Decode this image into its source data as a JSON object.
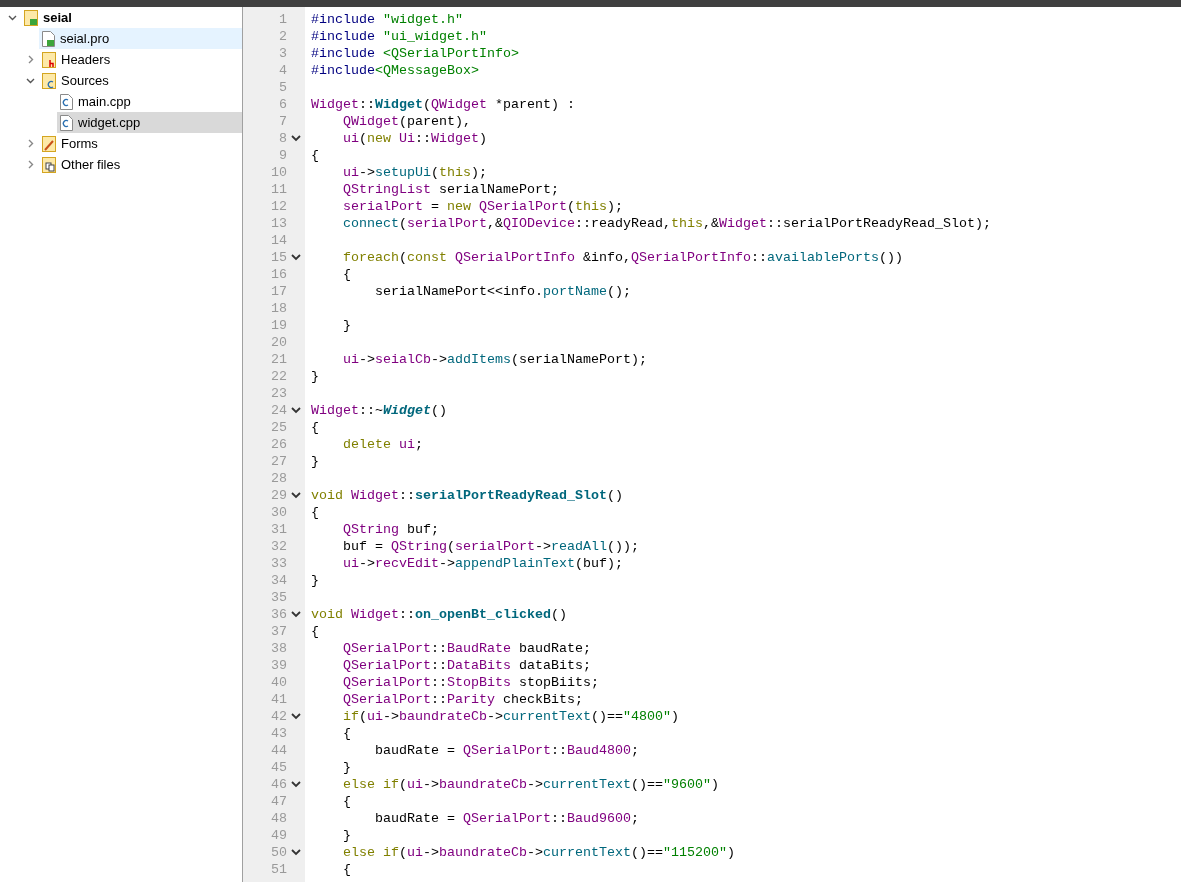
{
  "project_tree": [
    {
      "label": "seial",
      "kind": "project",
      "expanded": true,
      "selected": false,
      "open": false,
      "children": [
        {
          "label": "seial.pro",
          "kind": "pro-file",
          "selected": true,
          "open": false
        },
        {
          "label": "Headers",
          "kind": "headers",
          "expanded": false,
          "selected": false,
          "open": false
        },
        {
          "label": "Sources",
          "kind": "sources",
          "expanded": true,
          "selected": false,
          "open": false,
          "children": [
            {
              "label": "main.cpp",
              "kind": "cpp",
              "selected": false,
              "open": false
            },
            {
              "label": "widget.cpp",
              "kind": "cpp",
              "selected": false,
              "open": true
            }
          ]
        },
        {
          "label": "Forms",
          "kind": "forms",
          "expanded": false,
          "selected": false,
          "open": false
        },
        {
          "label": "Other files",
          "kind": "other",
          "expanded": false,
          "selected": false,
          "open": false
        }
      ]
    }
  ],
  "editor": {
    "lines": [
      {
        "number": "1",
        "foldable": false,
        "tokens": [
          {
            "kind": "pp",
            "text": "#include "
          },
          {
            "kind": "str",
            "text": "\"widget.h\""
          }
        ]
      },
      {
        "number": "2",
        "foldable": false,
        "tokens": [
          {
            "kind": "pp",
            "text": "#include "
          },
          {
            "kind": "str",
            "text": "\"ui_widget.h\""
          }
        ]
      },
      {
        "number": "3",
        "foldable": false,
        "tokens": [
          {
            "kind": "pp",
            "text": "#include "
          },
          {
            "kind": "str",
            "text": "<QSerialPortInfo>"
          }
        ]
      },
      {
        "number": "4",
        "foldable": false,
        "tokens": [
          {
            "kind": "pp",
            "text": "#include"
          },
          {
            "kind": "str",
            "text": "<QMessageBox>"
          }
        ]
      },
      {
        "number": "5",
        "foldable": false
      },
      {
        "number": "6",
        "foldable": false,
        "tokens": [
          {
            "kind": "type",
            "text": "Widget"
          },
          {
            "kind": "plain",
            "text": "::"
          },
          {
            "kind": "decl",
            "text": "Widget"
          },
          {
            "kind": "plain",
            "text": "("
          },
          {
            "kind": "type",
            "text": "QWidget"
          },
          {
            "kind": "plain",
            "text": " *parent) :"
          }
        ]
      },
      {
        "number": "7",
        "foldable": false,
        "tokens": [
          {
            "kind": "type",
            "text": "    QWidget"
          },
          {
            "kind": "plain",
            "text": "(parent),"
          }
        ]
      },
      {
        "number": "8",
        "foldable": true,
        "tokens": [
          {
            "kind": "type",
            "text": "    ui"
          },
          {
            "kind": "plain",
            "text": "("
          },
          {
            "kind": "kw",
            "text": "new "
          },
          {
            "kind": "type",
            "text": "Ui"
          },
          {
            "kind": "plain",
            "text": "::"
          },
          {
            "kind": "type",
            "text": "Widget"
          },
          {
            "kind": "plain",
            "text": ")"
          }
        ]
      },
      {
        "number": "9",
        "foldable": false,
        "tokens": [
          {
            "kind": "plain",
            "text": "{"
          }
        ]
      },
      {
        "number": "10",
        "foldable": false,
        "tokens": [
          {
            "kind": "type",
            "text": "    ui"
          },
          {
            "kind": "plain",
            "text": "->"
          },
          {
            "kind": "fn",
            "text": "setupUi"
          },
          {
            "kind": "plain",
            "text": "("
          },
          {
            "kind": "kw",
            "text": "this"
          },
          {
            "kind": "plain",
            "text": ");"
          }
        ]
      },
      {
        "number": "11",
        "foldable": false,
        "tokens": [
          {
            "kind": "type",
            "text": "    QStringList"
          },
          {
            "kind": "plain",
            "text": " serialNamePort;"
          }
        ]
      },
      {
        "number": "12",
        "foldable": false,
        "tokens": [
          {
            "kind": "type",
            "text": "    serialPort"
          },
          {
            "kind": "plain",
            "text": " = "
          },
          {
            "kind": "kw",
            "text": "new "
          },
          {
            "kind": "type",
            "text": "QSerialPort"
          },
          {
            "kind": "plain",
            "text": "("
          },
          {
            "kind": "kw",
            "text": "this"
          },
          {
            "kind": "plain",
            "text": ");"
          }
        ]
      },
      {
        "number": "13",
        "foldable": false,
        "tokens": [
          {
            "kind": "fn",
            "text": "    connect"
          },
          {
            "kind": "plain",
            "text": "("
          },
          {
            "kind": "type",
            "text": "serialPort"
          },
          {
            "kind": "plain",
            "text": ",&"
          },
          {
            "kind": "type",
            "text": "QIODevice"
          },
          {
            "kind": "plain",
            "text": "::readyRead,"
          },
          {
            "kind": "kw",
            "text": "this"
          },
          {
            "kind": "plain",
            "text": ",&"
          },
          {
            "kind": "type",
            "text": "Widget"
          },
          {
            "kind": "plain",
            "text": "::serialPortReadyRead_Slot);"
          }
        ]
      },
      {
        "number": "14",
        "foldable": false
      },
      {
        "number": "15",
        "foldable": true,
        "tokens": [
          {
            "kind": "kw",
            "text": "    foreach"
          },
          {
            "kind": "plain",
            "text": "("
          },
          {
            "kind": "kw",
            "text": "const "
          },
          {
            "kind": "type",
            "text": "QSerialPortInfo"
          },
          {
            "kind": "plain",
            "text": " &info,"
          },
          {
            "kind": "type",
            "text": "QSerialPortInfo"
          },
          {
            "kind": "plain",
            "text": "::"
          },
          {
            "kind": "fn",
            "text": "availablePorts"
          },
          {
            "kind": "plain",
            "text": "())"
          }
        ]
      },
      {
        "number": "16",
        "foldable": false,
        "tokens": [
          {
            "kind": "plain",
            "text": "    {"
          }
        ]
      },
      {
        "number": "17",
        "foldable": false,
        "tokens": [
          {
            "kind": "plain",
            "text": "        serialNamePort<<info."
          },
          {
            "kind": "fn",
            "text": "portName"
          },
          {
            "kind": "plain",
            "text": "();"
          }
        ]
      },
      {
        "number": "18",
        "foldable": false
      },
      {
        "number": "19",
        "foldable": false,
        "tokens": [
          {
            "kind": "plain",
            "text": "    }"
          }
        ]
      },
      {
        "number": "20",
        "foldable": false
      },
      {
        "number": "21",
        "foldable": false,
        "tokens": [
          {
            "kind": "type",
            "text": "    ui"
          },
          {
            "kind": "plain",
            "text": "->"
          },
          {
            "kind": "type",
            "text": "seialCb"
          },
          {
            "kind": "plain",
            "text": "->"
          },
          {
            "kind": "fn",
            "text": "addItems"
          },
          {
            "kind": "plain",
            "text": "(serialNamePort);"
          }
        ]
      },
      {
        "number": "22",
        "foldable": false,
        "tokens": [
          {
            "kind": "plain",
            "text": "}"
          }
        ]
      },
      {
        "number": "23",
        "foldable": false
      },
      {
        "number": "24",
        "foldable": true,
        "tokens": [
          {
            "kind": "type",
            "text": "Widget"
          },
          {
            "kind": "plain",
            "text": "::~"
          },
          {
            "kind": "decl-italic",
            "text": "Widget"
          },
          {
            "kind": "plain",
            "text": "()"
          }
        ]
      },
      {
        "number": "25",
        "foldable": false,
        "tokens": [
          {
            "kind": "plain",
            "text": "{"
          }
        ]
      },
      {
        "number": "26",
        "foldable": false,
        "tokens": [
          {
            "kind": "kw",
            "text": "    delete "
          },
          {
            "kind": "type",
            "text": "ui"
          },
          {
            "kind": "plain",
            "text": ";"
          }
        ]
      },
      {
        "number": "27",
        "foldable": false,
        "tokens": [
          {
            "kind": "plain",
            "text": "}"
          }
        ]
      },
      {
        "number": "28",
        "foldable": false
      },
      {
        "number": "29",
        "foldable": true,
        "tokens": [
          {
            "kind": "kw",
            "text": "void "
          },
          {
            "kind": "type",
            "text": "Widget"
          },
          {
            "kind": "plain",
            "text": "::"
          },
          {
            "kind": "decl",
            "text": "serialPortReadyRead_Slot"
          },
          {
            "kind": "plain",
            "text": "()"
          }
        ]
      },
      {
        "number": "30",
        "foldable": false,
        "tokens": [
          {
            "kind": "plain",
            "text": "{"
          }
        ]
      },
      {
        "number": "31",
        "foldable": false,
        "tokens": [
          {
            "kind": "type",
            "text": "    QString"
          },
          {
            "kind": "plain",
            "text": " buf;"
          }
        ]
      },
      {
        "number": "32",
        "foldable": false,
        "tokens": [
          {
            "kind": "plain",
            "text": "    buf = "
          },
          {
            "kind": "type",
            "text": "QString"
          },
          {
            "kind": "plain",
            "text": "("
          },
          {
            "kind": "type",
            "text": "serialPort"
          },
          {
            "kind": "plain",
            "text": "->"
          },
          {
            "kind": "fn",
            "text": "readAll"
          },
          {
            "kind": "plain",
            "text": "());"
          }
        ]
      },
      {
        "number": "33",
        "foldable": false,
        "tokens": [
          {
            "kind": "type",
            "text": "    ui"
          },
          {
            "kind": "plain",
            "text": "->"
          },
          {
            "kind": "type",
            "text": "recvEdit"
          },
          {
            "kind": "plain",
            "text": "->"
          },
          {
            "kind": "fn",
            "text": "appendPlainText"
          },
          {
            "kind": "plain",
            "text": "(buf);"
          }
        ]
      },
      {
        "number": "34",
        "foldable": false,
        "tokens": [
          {
            "kind": "plain",
            "text": "}"
          }
        ]
      },
      {
        "number": "35",
        "foldable": false
      },
      {
        "number": "36",
        "foldable": true,
        "tokens": [
          {
            "kind": "kw",
            "text": "void "
          },
          {
            "kind": "type",
            "text": "Widget"
          },
          {
            "kind": "plain",
            "text": "::"
          },
          {
            "kind": "decl",
            "text": "on_openBt_clicked"
          },
          {
            "kind": "plain",
            "text": "()"
          }
        ]
      },
      {
        "number": "37",
        "foldable": false,
        "tokens": [
          {
            "kind": "plain",
            "text": "{"
          }
        ]
      },
      {
        "number": "38",
        "foldable": false,
        "tokens": [
          {
            "kind": "type",
            "text": "    QSerialPort"
          },
          {
            "kind": "plain",
            "text": "::"
          },
          {
            "kind": "type",
            "text": "BaudRate"
          },
          {
            "kind": "plain",
            "text": " baudRate;"
          }
        ]
      },
      {
        "number": "39",
        "foldable": false,
        "tokens": [
          {
            "kind": "type",
            "text": "    QSerialPort"
          },
          {
            "kind": "plain",
            "text": "::"
          },
          {
            "kind": "type",
            "text": "DataBits"
          },
          {
            "kind": "plain",
            "text": " dataBits;"
          }
        ]
      },
      {
        "number": "40",
        "foldable": false,
        "tokens": [
          {
            "kind": "type",
            "text": "    QSerialPort"
          },
          {
            "kind": "plain",
            "text": "::"
          },
          {
            "kind": "type",
            "text": "StopBits"
          },
          {
            "kind": "plain",
            "text": " stopBiits;"
          }
        ]
      },
      {
        "number": "41",
        "foldable": false,
        "tokens": [
          {
            "kind": "type",
            "text": "    QSerialPort"
          },
          {
            "kind": "plain",
            "text": "::"
          },
          {
            "kind": "type",
            "text": "Parity"
          },
          {
            "kind": "plain",
            "text": " checkBits;"
          }
        ]
      },
      {
        "number": "42",
        "foldable": true,
        "tokens": [
          {
            "kind": "kw",
            "text": "    if"
          },
          {
            "kind": "plain",
            "text": "("
          },
          {
            "kind": "type",
            "text": "ui"
          },
          {
            "kind": "plain",
            "text": "->"
          },
          {
            "kind": "type",
            "text": "baundrateCb"
          },
          {
            "kind": "plain",
            "text": "->"
          },
          {
            "kind": "fn",
            "text": "currentText"
          },
          {
            "kind": "plain",
            "text": "()=="
          },
          {
            "kind": "str",
            "text": "\"4800\""
          },
          {
            "kind": "plain",
            "text": ")"
          }
        ]
      },
      {
        "number": "43",
        "foldable": false,
        "tokens": [
          {
            "kind": "plain",
            "text": "    {"
          }
        ]
      },
      {
        "number": "44",
        "foldable": false,
        "tokens": [
          {
            "kind": "plain",
            "text": "        baudRate = "
          },
          {
            "kind": "type",
            "text": "QSerialPort"
          },
          {
            "kind": "plain",
            "text": "::"
          },
          {
            "kind": "type",
            "text": "Baud4800"
          },
          {
            "kind": "plain",
            "text": ";"
          }
        ]
      },
      {
        "number": "45",
        "foldable": false,
        "tokens": [
          {
            "kind": "plain",
            "text": "    }"
          }
        ]
      },
      {
        "number": "46",
        "foldable": true,
        "tokens": [
          {
            "kind": "kw",
            "text": "    else if"
          },
          {
            "kind": "plain",
            "text": "("
          },
          {
            "kind": "type",
            "text": "ui"
          },
          {
            "kind": "plain",
            "text": "->"
          },
          {
            "kind": "type",
            "text": "baundrateCb"
          },
          {
            "kind": "plain",
            "text": "->"
          },
          {
            "kind": "fn",
            "text": "currentText"
          },
          {
            "kind": "plain",
            "text": "()=="
          },
          {
            "kind": "str",
            "text": "\"9600\""
          },
          {
            "kind": "plain",
            "text": ")"
          }
        ]
      },
      {
        "number": "47",
        "foldable": false,
        "tokens": [
          {
            "kind": "plain",
            "text": "    {"
          }
        ]
      },
      {
        "number": "48",
        "foldable": false,
        "tokens": [
          {
            "kind": "plain",
            "text": "        baudRate = "
          },
          {
            "kind": "type",
            "text": "QSerialPort"
          },
          {
            "kind": "plain",
            "text": "::"
          },
          {
            "kind": "type",
            "text": "Baud9600"
          },
          {
            "kind": "plain",
            "text": ";"
          }
        ]
      },
      {
        "number": "49",
        "foldable": false,
        "tokens": [
          {
            "kind": "plain",
            "text": "    }"
          }
        ]
      },
      {
        "number": "50",
        "foldable": true,
        "tokens": [
          {
            "kind": "kw",
            "text": "    else if"
          },
          {
            "kind": "plain",
            "text": "("
          },
          {
            "kind": "type",
            "text": "ui"
          },
          {
            "kind": "plain",
            "text": "->"
          },
          {
            "kind": "type",
            "text": "baundrateCb"
          },
          {
            "kind": "plain",
            "text": "->"
          },
          {
            "kind": "fn",
            "text": "currentText"
          },
          {
            "kind": "plain",
            "text": "()=="
          },
          {
            "kind": "str",
            "text": "\"115200\""
          },
          {
            "kind": "plain",
            "text": ")"
          }
        ]
      },
      {
        "number": "51",
        "foldable": false,
        "tokens": [
          {
            "kind": "plain",
            "text": "    {"
          }
        ]
      }
    ]
  }
}
